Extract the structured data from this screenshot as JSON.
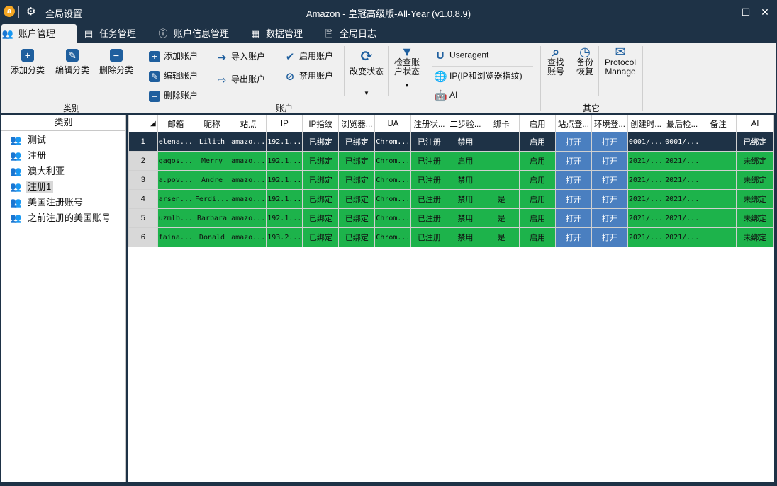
{
  "titlebar": {
    "logo": "a",
    "settings": "全局设置",
    "title": "Amazon - 皇冠高级版-All-Year  (v1.0.8.9)",
    "minimize": "—",
    "maximize": "☐",
    "close": "✕"
  },
  "tabs": [
    {
      "label": "账户管理",
      "icon": "users-icon"
    },
    {
      "label": "任务管理",
      "icon": "list-icon"
    },
    {
      "label": "账户信息管理",
      "icon": "info-icon"
    },
    {
      "label": "数据管理",
      "icon": "grid-icon"
    },
    {
      "label": "全局日志",
      "icon": "doc-icon"
    }
  ],
  "ribbon": {
    "category": {
      "label": "类别",
      "add": "添加分类",
      "edit": "编辑分类",
      "delete": "删除分类"
    },
    "account": {
      "label": "账户",
      "add": "添加账户",
      "edit": "编辑账户",
      "delete": "删除账户",
      "import": "导入账户",
      "export": "导出账户",
      "enable": "启用账户",
      "disable": "禁用账户",
      "change_status": "改变状态",
      "check_status_1": "检查账",
      "check_status_2": "户状态"
    },
    "useragent": "Useragent",
    "ip": "IP(IP和浏览器指纹)",
    "ai": "AI",
    "other": {
      "label": "其它",
      "find_1": "查找",
      "find_2": "账号",
      "backup_1": "备份",
      "backup_2": "恢复",
      "protocol_1": "Protocol",
      "protocol_2": "Manage"
    }
  },
  "left_panel": {
    "header": "类别",
    "items": [
      "测试",
      "注册",
      "澳大利亚",
      "注册1",
      "美国注册账号",
      "之前注册的美国账号"
    ],
    "selected": "注册1"
  },
  "grid": {
    "columns": [
      "",
      "邮箱",
      "昵称",
      "站点",
      "IP",
      "IP指纹",
      "浏览器...",
      "UA",
      "注册状...",
      "二步验...",
      "绑卡",
      "启用",
      "站点登...",
      "环境登...",
      "创建时...",
      "最后检...",
      "备注",
      "AI"
    ],
    "rows": [
      {
        "num": "1",
        "email": "elena...",
        "nick": "Lilith",
        "site": "amazo...",
        "ip": "192.1...",
        "ipfp": "已绑定",
        "browser": "已绑定",
        "ua": "Chrom...",
        "reg": "已注册",
        "twostep": "禁用",
        "card": "",
        "enabled": "启用",
        "site_login": "打开",
        "env_login": "打开",
        "created": "0001/...",
        "last": "0001/...",
        "note": "",
        "ai": "已绑定"
      },
      {
        "num": "2",
        "email": "gagos...",
        "nick": "Merry",
        "site": "amazo...",
        "ip": "192.1...",
        "ipfp": "已绑定",
        "browser": "已绑定",
        "ua": "Chrom...",
        "reg": "已注册",
        "twostep": "启用",
        "card": "",
        "enabled": "启用",
        "site_login": "打开",
        "env_login": "打开",
        "created": "2021/...",
        "last": "2021/...",
        "note": "",
        "ai": "未绑定"
      },
      {
        "num": "3",
        "email": "a.pov...",
        "nick": "Andre",
        "site": "amazo...",
        "ip": "192.1...",
        "ipfp": "已绑定",
        "browser": "已绑定",
        "ua": "Chrom...",
        "reg": "已注册",
        "twostep": "禁用",
        "card": "",
        "enabled": "启用",
        "site_login": "打开",
        "env_login": "打开",
        "created": "2021/...",
        "last": "2021/...",
        "note": "",
        "ai": "未绑定"
      },
      {
        "num": "4",
        "email": "arsen...",
        "nick": "Ferdi...",
        "site": "amazo...",
        "ip": "192.1...",
        "ipfp": "已绑定",
        "browser": "已绑定",
        "ua": "Chrom...",
        "reg": "已注册",
        "twostep": "禁用",
        "card": "是",
        "enabled": "启用",
        "site_login": "打开",
        "env_login": "打开",
        "created": "2021/...",
        "last": "2021/...",
        "note": "",
        "ai": "未绑定"
      },
      {
        "num": "5",
        "email": "uzmlb...",
        "nick": "Barbara",
        "site": "amazo...",
        "ip": "192.1...",
        "ipfp": "已绑定",
        "browser": "已绑定",
        "ua": "Chrom...",
        "reg": "已注册",
        "twostep": "禁用",
        "card": "是",
        "enabled": "启用",
        "site_login": "打开",
        "env_login": "打开",
        "created": "2021/...",
        "last": "2021/...",
        "note": "",
        "ai": "未绑定"
      },
      {
        "num": "6",
        "email": "faina...",
        "nick": "Donald",
        "site": "amazo...",
        "ip": "193.2...",
        "ipfp": "已绑定",
        "browser": "已绑定",
        "ua": "Chrom...",
        "reg": "已注册",
        "twostep": "禁用",
        "card": "是",
        "enabled": "启用",
        "site_login": "打开",
        "env_login": "打开",
        "created": "2021/...",
        "last": "2021/...",
        "note": "",
        "ai": "未绑定"
      }
    ]
  },
  "colors": {
    "frame": "#1e3246",
    "row_green": "#1db34b",
    "cell_blue": "#4a7fc0",
    "accent": "#1f5f9e"
  }
}
